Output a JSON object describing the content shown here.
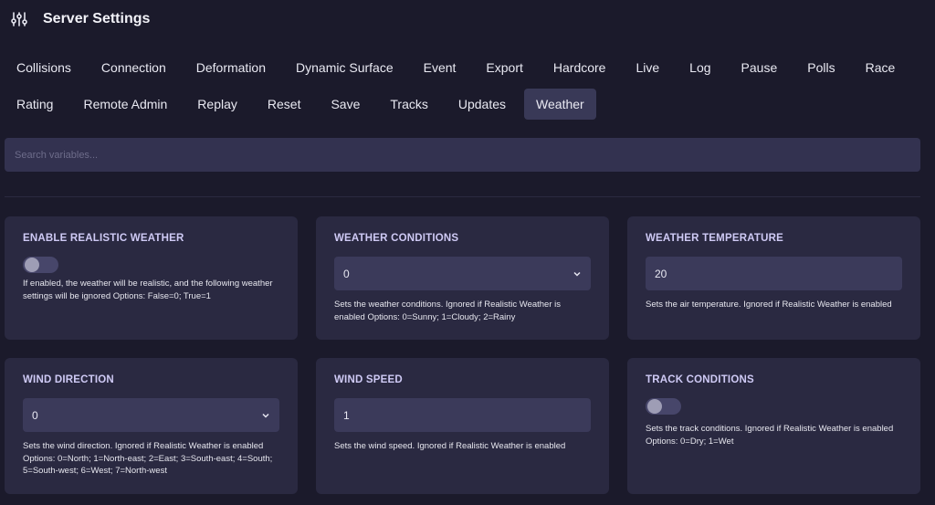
{
  "header": {
    "title": "Server Settings",
    "icon": "sliders-icon"
  },
  "tabs_row1": [
    "Collisions",
    "Connection",
    "Deformation",
    "Dynamic Surface",
    "Event",
    "Export",
    "Hardcore",
    "Live",
    "Log",
    "Pause",
    "Polls",
    "Race"
  ],
  "tabs_row2": [
    "Rating",
    "Remote Admin",
    "Replay",
    "Reset",
    "Save",
    "Tracks",
    "Updates",
    "Weather"
  ],
  "active_tab": "Weather",
  "search": {
    "placeholder": "Search variables...",
    "value": ""
  },
  "cards": {
    "realistic_weather": {
      "title": "ENABLE REALISTIC WEATHER",
      "enabled": false,
      "description": "If enabled, the weather will be realistic, and the following weather settings will be ignored Options: False=0; True=1"
    },
    "weather_conditions": {
      "title": "WEATHER CONDITIONS",
      "value": "0",
      "description": "Sets the weather conditions. Ignored if Realistic Weather is enabled Options: 0=Sunny; 1=Cloudy; 2=Rainy"
    },
    "weather_temperature": {
      "title": "WEATHER TEMPERATURE",
      "value": "20",
      "description": "Sets the air temperature. Ignored if Realistic Weather is enabled"
    },
    "wind_direction": {
      "title": "WIND DIRECTION",
      "value": "0",
      "description": "Sets the wind direction. Ignored if Realistic Weather is enabled Options: 0=North; 1=North-east; 2=East; 3=South-east; 4=South; 5=South-west; 6=West; 7=North-west"
    },
    "wind_speed": {
      "title": "WIND SPEED",
      "value": "1",
      "description": "Sets the wind speed. Ignored if Realistic Weather is enabled"
    },
    "track_conditions": {
      "title": "TRACK CONDITIONS",
      "enabled": false,
      "description": "Sets the track conditions. Ignored if Realistic Weather is enabled Options: 0=Dry; 1=Wet"
    }
  },
  "colors": {
    "background": "#1b1a2b",
    "card": "#2a2941",
    "active_tab": "#393957",
    "title_accent": "#cfcaf5"
  }
}
